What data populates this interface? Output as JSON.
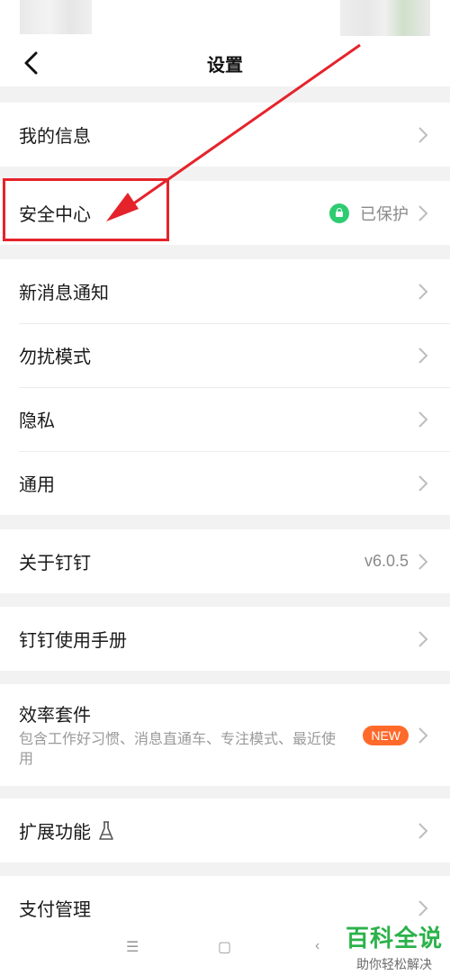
{
  "header": {
    "title": "设置"
  },
  "groups": [
    {
      "items": [
        {
          "label": "我的信息"
        }
      ]
    },
    {
      "items": [
        {
          "label": "安全中心",
          "value": "已保护"
        }
      ]
    },
    {
      "items": [
        {
          "label": "新消息通知"
        },
        {
          "label": "勿扰模式"
        },
        {
          "label": "隐私"
        },
        {
          "label": "通用"
        }
      ]
    },
    {
      "items": [
        {
          "label": "关于钉钉",
          "value": "v6.0.5"
        }
      ]
    },
    {
      "items": [
        {
          "label": "钉钉使用手册"
        }
      ]
    },
    {
      "items": [
        {
          "label": "效率套件",
          "subtitle": "包含工作好习惯、消息直通车、专注模式、最近使用",
          "badge": "NEW"
        }
      ]
    },
    {
      "items": [
        {
          "label": "扩展功能"
        }
      ]
    },
    {
      "items": [
        {
          "label": "支付管理"
        }
      ]
    }
  ],
  "navkeys": {
    "menu": "☰",
    "home": "▢",
    "back": "‹"
  },
  "watermark": {
    "main": "百科全说",
    "sub": "助你轻松解决"
  },
  "colors": {
    "highlight": "#e5232b",
    "lock_green": "#2ecc71",
    "badge": "#ff6a2b",
    "watermark_green": "#2bb24a"
  }
}
